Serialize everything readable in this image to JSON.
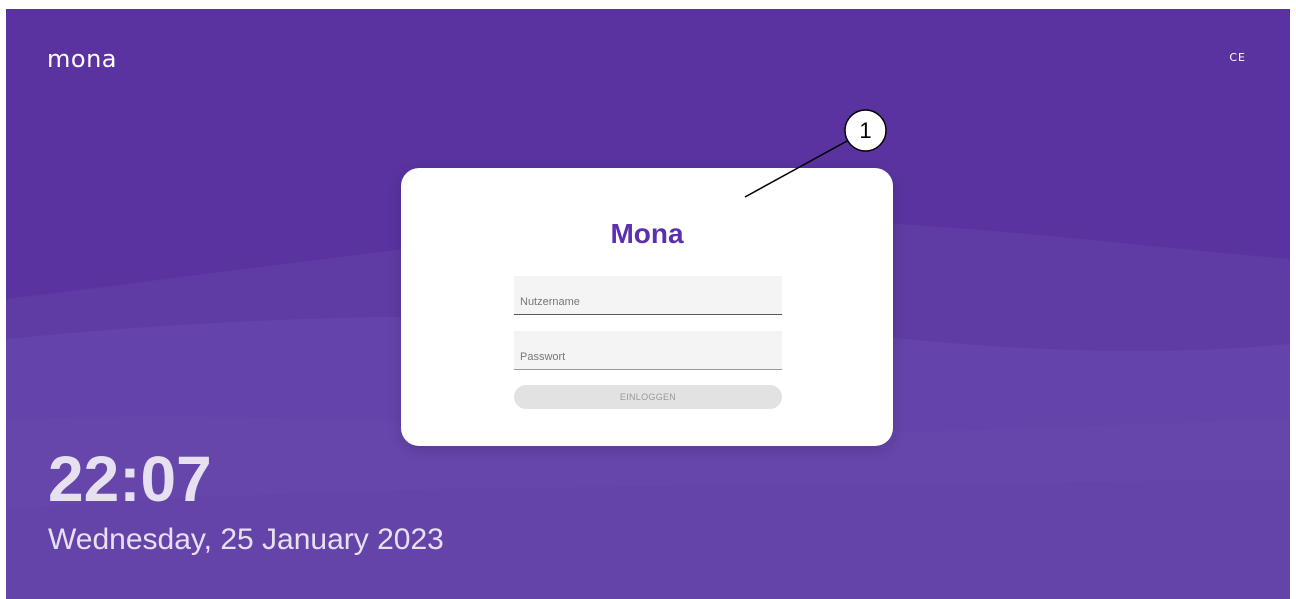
{
  "header": {
    "brand": "mona",
    "ce_mark": "CE"
  },
  "login": {
    "title": "Mona",
    "username_placeholder": "Nutzername",
    "password_placeholder": "Passwort",
    "login_button": "EINLOGGEN"
  },
  "status": {
    "time": "22:07",
    "date": "Wednesday, 25 January 2023"
  },
  "callout": {
    "label": "1"
  },
  "colors": {
    "background": "#5a33a0",
    "title": "#5b2fb0",
    "card": "#ffffff"
  }
}
